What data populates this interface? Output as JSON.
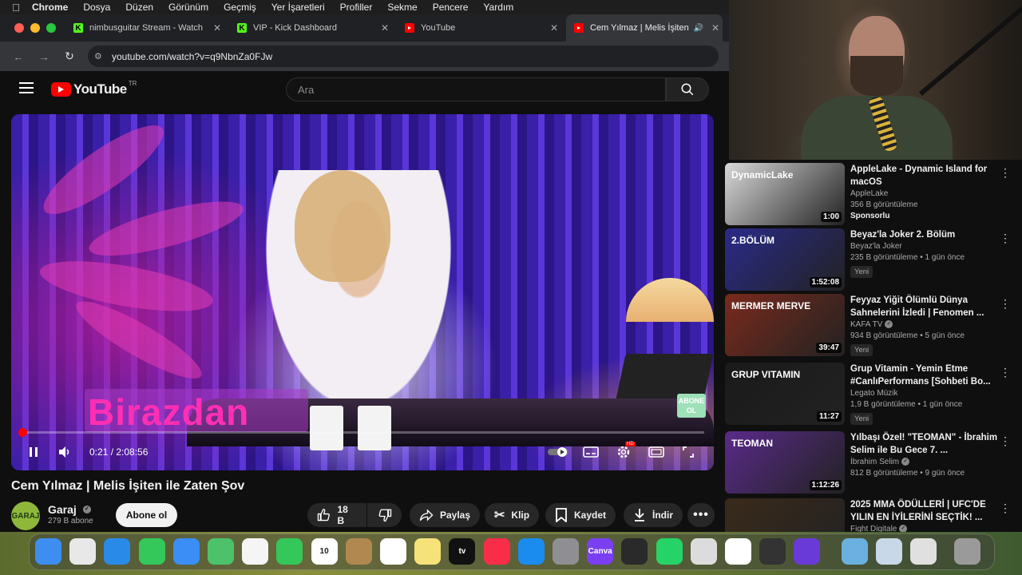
{
  "menubar": {
    "apple": "",
    "items": [
      "Chrome",
      "Dosya",
      "Düzen",
      "Görünüm",
      "Geçmiş",
      "Yer İşaretleri",
      "Profiller",
      "Sekme",
      "Pencere",
      "Yardım"
    ]
  },
  "tabs": [
    {
      "label": "nimbusguitar Stream - Watch",
      "icon": "kick-icon",
      "active": false
    },
    {
      "label": "VIP - Kick Dashboard",
      "icon": "kick-icon",
      "active": false
    },
    {
      "label": "YouTube",
      "icon": "youtube-icon",
      "active": false
    },
    {
      "label": "Cem Yılmaz | Melis İşiten",
      "icon": "youtube-icon",
      "active": true
    }
  ],
  "address": {
    "url": "youtube.com/watch?v=q9NbnZa0FJw"
  },
  "header": {
    "logo_text": "YouTube",
    "country": "TR",
    "search_placeholder": "Ara"
  },
  "player": {
    "overlay_text": "Birazdan",
    "badge_text": "ABONE OL",
    "time": "0:21 / 2:08:56",
    "progress_fraction": 0.0027,
    "settings_badge": "HD"
  },
  "video": {
    "title": "Cem Yılmaz | Melis İşiten ile Zaten Şov",
    "channel": "Garaj",
    "channel_avatar": "GARAJ",
    "subscribers": "279 B abone",
    "subscribe_label": "Abone ol",
    "likes": "18 B",
    "share_label": "Paylaş",
    "clip_label": "Klip",
    "save_label": "Kaydet",
    "download_label": "İndir"
  },
  "recommendations": [
    {
      "title": "AppleLake - Dynamic Island for macOS",
      "channel": "AppleLake",
      "verified": false,
      "meta": "356 B görüntüleme",
      "badge": "Sponsorlu",
      "duration": "1:00",
      "thumb_text": "DynamicLake",
      "thumb_color": "#d9d9d9"
    },
    {
      "title": "Beyaz'la Joker 2. Bölüm",
      "channel": "Beyaz'la Joker",
      "verified": false,
      "meta": "235 B görüntüleme • 1 gün önce",
      "badge": "Yeni",
      "duration": "1:52:08",
      "thumb_text": "2.BÖLÜM",
      "thumb_color": "#2a2a8a"
    },
    {
      "title": "Feyyaz Yiğit Ölümlü Dünya Sahnelerini İzledi | Fenomen ...",
      "channel": "KAFA TV",
      "verified": true,
      "meta": "934 B görüntüleme • 5 gün önce",
      "badge": "Yeni",
      "duration": "39:47",
      "thumb_text": "MERMER MERVE",
      "thumb_color": "#7a2a1c"
    },
    {
      "title": "Grup Vitamin - Yemin Etme #CanlıPerformans [Sohbeti Bo...",
      "channel": "Legato Müzik",
      "verified": false,
      "meta": "1,9 B görüntüleme • 1 gün önce",
      "badge": "Yeni",
      "duration": "11:27",
      "thumb_text": "GRUP VITAMIN",
      "thumb_color": "#1a1a1a"
    },
    {
      "title": "Yılbaşı Özel! \"TEOMAN\" - İbrahim Selim ile Bu Gece 7. ...",
      "channel": "İbrahim Selim",
      "verified": true,
      "meta": "812 B görüntüleme • 9 gün önce",
      "badge": "",
      "duration": "1:12:26",
      "thumb_text": "TEOMAN",
      "thumb_color": "#5a2a8a"
    },
    {
      "title": "2025 MMA ÖDÜLLERİ | UFC'DE YILIN EN İYİLERİNİ SEÇTİK! ...",
      "channel": "Fight Digitale",
      "verified": true,
      "meta": "",
      "badge": "",
      "duration": "",
      "thumb_text": "",
      "thumb_color": "#3a2a1a"
    }
  ],
  "dock": [
    {
      "name": "finder-icon",
      "color": "#3d8ef0",
      "label": ""
    },
    {
      "name": "launchpad-icon",
      "color": "#e8e8e8",
      "label": ""
    },
    {
      "name": "safari-icon",
      "color": "#2a8ae8",
      "label": ""
    },
    {
      "name": "messages-icon",
      "color": "#34c759",
      "label": ""
    },
    {
      "name": "mail-icon",
      "color": "#3a8ef6",
      "label": ""
    },
    {
      "name": "maps-icon",
      "color": "#4cc36a",
      "label": ""
    },
    {
      "name": "photos-icon",
      "color": "#f5f5f5",
      "label": ""
    },
    {
      "name": "facetime-icon",
      "color": "#34c759",
      "label": ""
    },
    {
      "name": "calendar-icon",
      "color": "#ffffff",
      "label": "10"
    },
    {
      "name": "contacts-icon",
      "color": "#b08850",
      "label": ""
    },
    {
      "name": "reminders-icon",
      "color": "#ffffff",
      "label": ""
    },
    {
      "name": "notes-icon",
      "color": "#f7e27a",
      "label": ""
    },
    {
      "name": "tv-icon",
      "color": "#111111",
      "label": "tv"
    },
    {
      "name": "music-icon",
      "color": "#fa2d48",
      "label": ""
    },
    {
      "name": "appstore-icon",
      "color": "#1a8cf0",
      "label": ""
    },
    {
      "name": "settings-icon",
      "color": "#8e8e93",
      "label": ""
    },
    {
      "name": "canva-icon",
      "color": "#7a3ff0",
      "label": "Canva"
    },
    {
      "name": "obs-icon",
      "color": "#2a2a2a",
      "label": ""
    },
    {
      "name": "whatsapp-icon",
      "color": "#25d366",
      "label": ""
    },
    {
      "name": "steam-icon",
      "color": "#dcdcdc",
      "label": ""
    },
    {
      "name": "chrome-icon",
      "color": "#ffffff",
      "label": ""
    },
    {
      "name": "calculator-icon",
      "color": "#333333",
      "label": ""
    },
    {
      "name": "imovie-icon",
      "color": "#6a3ad8",
      "label": ""
    },
    {
      "name": "preview-icon",
      "color": "#6ab0e0",
      "label": ""
    },
    {
      "name": "quicktime-icon",
      "color": "#c8d8e8",
      "label": ""
    },
    {
      "name": "drive-icon",
      "color": "#e0e0e0",
      "label": ""
    },
    {
      "name": "trash-icon",
      "color": "#9a9a9a",
      "label": ""
    }
  ]
}
